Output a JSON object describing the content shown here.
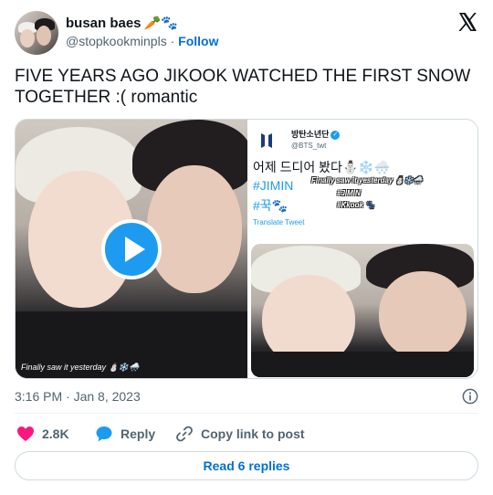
{
  "author": {
    "display_name": "busan baes",
    "name_emoji": "🥕🐾",
    "handle": "@stopkookminpls",
    "separator": "·",
    "follow_label": "Follow"
  },
  "tweet": {
    "text": "FIVE YEARS AGO JIKOOK WATCHED THE FIRST SNOW TOGETHER :( romantic",
    "timestamp": "3:16 PM · Jan 8, 2023"
  },
  "media": {
    "video_caption": "Finally saw it yesterday ⛄❄️🌨️",
    "embedded_tweet": {
      "name": "방탄소년단",
      "verified_mark": "✓",
      "handle": "@BTS_twt",
      "line1": "어제 드디어 봤다⛄❄️🌨️",
      "line2": "#JIMIN",
      "line3": "#꾹🐾",
      "overlay_caption_1": "Finally saw it yesterday ⛄❄️🌨️",
      "overlay_caption_2": "#JIMIN",
      "overlay_caption_3": "#Kkook 🐾",
      "translate_label": "Translate Tweet"
    }
  },
  "actions": {
    "like_count": "2.8K",
    "reply_label": "Reply",
    "copy_label": "Copy link to post",
    "read_replies_label": "Read 6 replies"
  },
  "colors": {
    "accent": "#1d9bf0",
    "link": "#006fd6",
    "like": "#f91880",
    "secondary_text": "#536471",
    "border": "#cfd9de"
  },
  "icons": {
    "platform": "x-logo-icon",
    "like": "heart-icon",
    "reply": "speech-bubble-icon",
    "copy": "link-icon",
    "info": "info-icon",
    "play": "play-icon"
  }
}
